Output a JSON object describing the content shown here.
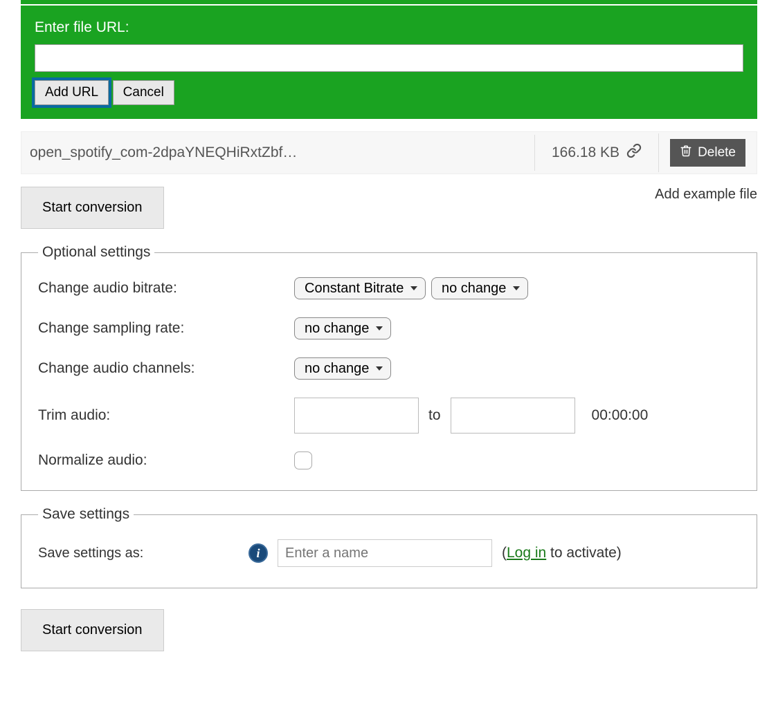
{
  "url_panel": {
    "label": "Enter file URL:",
    "value": "",
    "add_btn": "Add URL",
    "cancel_btn": "Cancel"
  },
  "file": {
    "name": "open_spotify_com-2dpaYNEQHiRxtZbf…",
    "size": "166.18 KB",
    "delete_btn": "Delete"
  },
  "start_btn": "Start conversion",
  "example_link": "Add example file",
  "optional": {
    "legend": "Optional settings",
    "bitrate_label": "Change audio bitrate:",
    "bitrate_mode": "Constant Bitrate",
    "bitrate_value": "no change",
    "sampling_label": "Change sampling rate:",
    "sampling_value": "no change",
    "channels_label": "Change audio channels:",
    "channels_value": "no change",
    "trim_label": "Trim audio:",
    "trim_to": "to",
    "trim_duration": "00:00:00",
    "normalize_label": "Normalize audio:"
  },
  "save": {
    "legend": "Save settings",
    "label": "Save settings as:",
    "placeholder": "Enter a name",
    "login_prefix": "(",
    "login_link": "Log in",
    "login_suffix": " to activate)"
  }
}
